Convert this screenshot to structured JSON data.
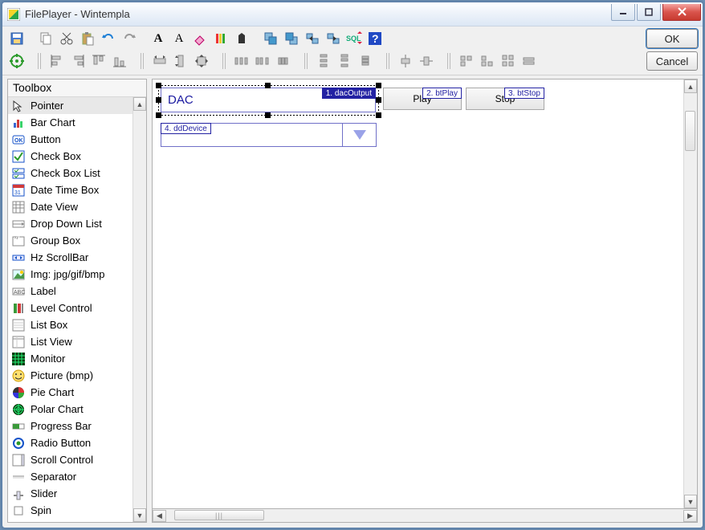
{
  "title": "FilePlayer   -   Wintempla",
  "dialogButtons": {
    "ok": "OK",
    "cancel": "Cancel"
  },
  "toolboxHeader": "Toolbox",
  "toolboxItems": [
    {
      "label": "Pointer"
    },
    {
      "label": "Bar Chart"
    },
    {
      "label": "Button"
    },
    {
      "label": "Check Box"
    },
    {
      "label": "Check Box List"
    },
    {
      "label": "Date Time Box"
    },
    {
      "label": "Date View"
    },
    {
      "label": "Drop Down List"
    },
    {
      "label": "Group Box"
    },
    {
      "label": "Hz ScrollBar"
    },
    {
      "label": "Img: jpg/gif/bmp"
    },
    {
      "label": "Label"
    },
    {
      "label": "Level Control"
    },
    {
      "label": "List Box"
    },
    {
      "label": "List View"
    },
    {
      "label": "Monitor"
    },
    {
      "label": "Picture (bmp)"
    },
    {
      "label": "Pie Chart"
    },
    {
      "label": "Polar Chart"
    },
    {
      "label": "Progress Bar"
    },
    {
      "label": "Radio Button"
    },
    {
      "label": "Scroll Control"
    },
    {
      "label": "Separator"
    },
    {
      "label": "Slider"
    },
    {
      "label": "Spin"
    }
  ],
  "controls": {
    "dac": {
      "label": "DAC",
      "tag": "1. dacOutput"
    },
    "play": {
      "label": "Play",
      "tag": "2. btPlay"
    },
    "stop": {
      "label": "Stop",
      "tag": "3. btStop"
    },
    "device": {
      "tag": "4. ddDevice"
    }
  }
}
